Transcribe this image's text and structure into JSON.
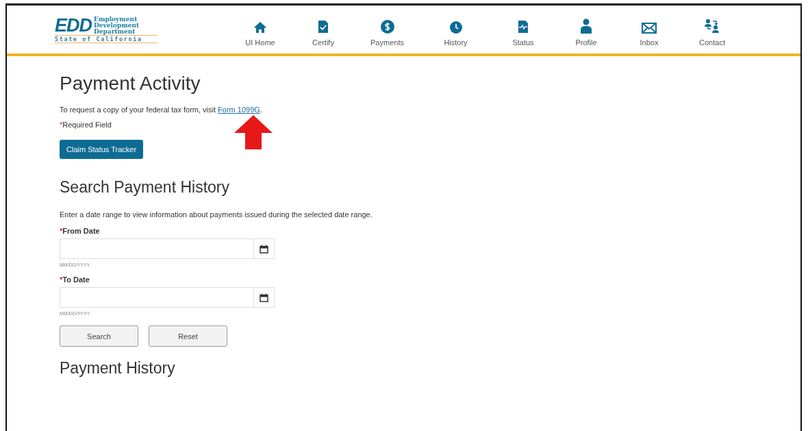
{
  "logo": {
    "mark": "EDD",
    "lines": [
      "Employment",
      "Development",
      "Department"
    ],
    "tagline": "State of California"
  },
  "nav": [
    {
      "kind": "home",
      "label": "UI Home"
    },
    {
      "kind": "certify",
      "label": "Certify"
    },
    {
      "kind": "payments",
      "label": "Payments"
    },
    {
      "kind": "history",
      "label": "History"
    },
    {
      "kind": "status",
      "label": "Status"
    },
    {
      "kind": "profile",
      "label": "Profile"
    },
    {
      "kind": "inbox",
      "label": "Inbox"
    },
    {
      "kind": "contact",
      "label": "Contact"
    }
  ],
  "title": "Payment Activity",
  "tax_note": {
    "text": "To request a copy of your federal tax form, visit ",
    "link": "Form 1099G",
    "after": "."
  },
  "required_mark": "*",
  "required_note": "Required Field",
  "tracker_button": "Claim Status Tracker",
  "search_title": "Search Payment History",
  "search_note": "Enter a date range to view information about payments issued during the selected date range.",
  "fields": [
    {
      "label": "From Date",
      "hint": "MM/DD/YYYY"
    },
    {
      "label": "To Date",
      "hint": "MM/DD/YYYY"
    }
  ],
  "buttons": [
    "Search",
    "Reset"
  ],
  "history_title": "Payment History"
}
